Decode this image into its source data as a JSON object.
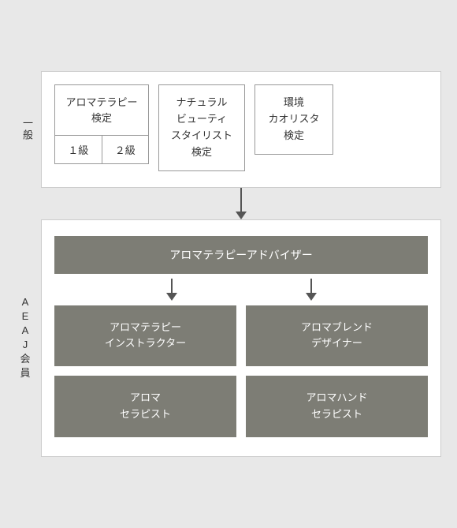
{
  "sections": {
    "general": {
      "label": "一般",
      "boxes": {
        "aromatherapy": {
          "title": "アロマテラピー\n検定",
          "grade1": "１級",
          "grade2": "２級"
        },
        "naturalBeauty": "ナチュラル\nビューティ\nスタイリスト\n検定",
        "kankyo": "環境\nカオリスタ\n検定"
      }
    },
    "aeaj": {
      "label_chars": [
        "A",
        "E",
        "A",
        "J",
        "会",
        "員"
      ],
      "advisor": "アロマテラピーアドバイザー",
      "instructor": "アロマテラピー\nインストラクター",
      "blendDesigner": "アロマブレンド\nデザイナー",
      "therapist": "アロマ\nセラピスト",
      "handTherapist": "アロマハンド\nセラピスト"
    }
  }
}
